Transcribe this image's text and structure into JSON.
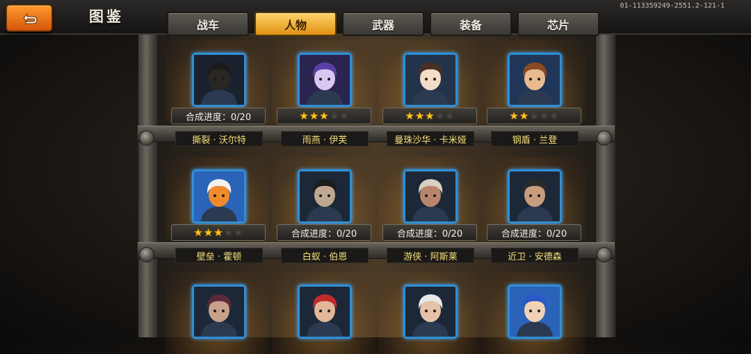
{
  "header": {
    "title": "图鉴",
    "build_id": "01-113359249-2551.2-121-1",
    "back_icon": "back-arrow-icon"
  },
  "tabs": [
    {
      "label": "战车",
      "active": false
    },
    {
      "label": "人物",
      "active": true
    },
    {
      "label": "武器",
      "active": false
    },
    {
      "label": "装备",
      "active": false
    },
    {
      "label": "芯片",
      "active": false
    }
  ],
  "characters": [
    {
      "name": "撕裂 · 沃尔特",
      "progress": "合成进度：0/20",
      "stars": null,
      "hair": "#1b1b1b",
      "skin": "#2a2622",
      "bg": "#1a2230"
    },
    {
      "name": "雨燕 · 伊芙",
      "progress": null,
      "stars": 3,
      "hair": "#5b3fa7",
      "skin": "#d9c7f2",
      "bg": "#2a2450"
    },
    {
      "name": "曼珠沙华 · 卡米娅",
      "progress": null,
      "stars": 3,
      "hair": "#4a3024",
      "skin": "#f3dcc8",
      "bg": "#23344a"
    },
    {
      "name": "钢盾 · 兰登",
      "progress": null,
      "stars": 2,
      "hair": "#8a4a22",
      "skin": "#e9b98f",
      "bg": "#1f3658"
    },
    {
      "name": "壁垒 · 霍顿",
      "progress": null,
      "stars": 3,
      "hair": "#f2f2f2",
      "skin": "#f08a2a",
      "bg": "#2a63b8"
    },
    {
      "name": "白蚁 · 伯恩",
      "progress": "合成进度：0/20",
      "stars": null,
      "hair": "#1c1c1c",
      "skin": "#bfa88f",
      "bg": "#1c2838"
    },
    {
      "name": "游侠 · 阿斯莱",
      "progress": "合成进度：0/20",
      "stars": null,
      "hair": "#d8d0c2",
      "skin": "#b8856a",
      "bg": "#1c2838"
    },
    {
      "name": "近卫 · 安德森",
      "progress": "合成进度：0/20",
      "stars": null,
      "hair": "#2a2a2a",
      "skin": "#c79d7e",
      "bg": "#1c2838"
    },
    {
      "name": "",
      "progress": null,
      "stars": null,
      "hair": "#5a2a3a",
      "skin": "#c9a08a",
      "bg": "#1c2838"
    },
    {
      "name": "",
      "progress": null,
      "stars": null,
      "hair": "#c22a2a",
      "skin": "#e3b69a",
      "bg": "#1c2838"
    },
    {
      "name": "",
      "progress": null,
      "stars": null,
      "hair": "#e8e8ea",
      "skin": "#e6c2a8",
      "bg": "#1c2838"
    },
    {
      "name": "",
      "progress": null,
      "stars": null,
      "hair": "#2a58c8",
      "skin": "#f0d2b6",
      "bg": "#2a63b8"
    }
  ]
}
